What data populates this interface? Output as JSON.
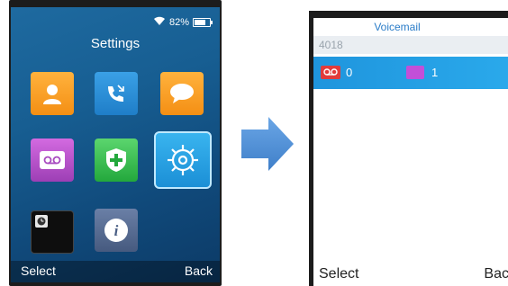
{
  "left_screen": {
    "status": {
      "wifi_icon": "wifi-icon",
      "battery_percent": "82%",
      "battery_icon": "battery-icon"
    },
    "title": "Settings",
    "apps": [
      {
        "name": "contacts",
        "icon": "contacts-icon"
      },
      {
        "name": "call-history",
        "icon": "call-history-icon"
      },
      {
        "name": "messages",
        "icon": "message-bubble-icon"
      },
      {
        "name": "voicemail",
        "icon": "voicemail-icon"
      },
      {
        "name": "security",
        "icon": "shield-plus-icon"
      },
      {
        "name": "settings",
        "icon": "gear-icon",
        "selected": true
      },
      {
        "name": "clock",
        "icon": "clock-icon"
      },
      {
        "name": "info",
        "icon": "info-icon"
      }
    ],
    "softkeys": {
      "left": "Select",
      "right": "Back"
    }
  },
  "transition_arrow": {
    "icon": "arrow-right-icon",
    "color": "#4a8fd8"
  },
  "right_screen": {
    "title": "Voicemail",
    "account_number": "4018",
    "voicemail_row": {
      "new_voicemail_icon": "voicemail-tape-icon",
      "new_count": "0",
      "old_voicemail_icon": "message-icon",
      "old_count": "1"
    },
    "softkeys": {
      "left": "Select",
      "right": "Back"
    }
  },
  "colors": {
    "accent_blue": "#2a7cc8",
    "selected_row": "#1f95dd",
    "voicemail_red": "#e23b3b",
    "voicemail_purple": "#c24fd8"
  }
}
